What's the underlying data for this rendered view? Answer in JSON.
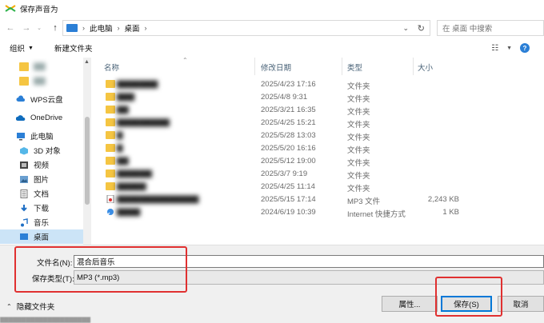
{
  "window": {
    "title": "保存声音为"
  },
  "nav": {
    "breadcrumb": [
      "此电脑",
      "桌面"
    ],
    "search_placeholder": "在 桌面 中搜索"
  },
  "toolbar": {
    "organize": "组织",
    "new_folder": "新建文件夹"
  },
  "sidebar": {
    "items": [
      {
        "label": "",
        "icon": "folder-icon",
        "blurred": true
      },
      {
        "label": "",
        "icon": "folder-icon",
        "blurred": true
      },
      {
        "label": "WPS云盘",
        "icon": "cloud-icon"
      },
      {
        "label": "OneDrive",
        "icon": "onedrive-icon"
      },
      {
        "label": "此电脑",
        "icon": "pc-icon"
      },
      {
        "label": "3D 对象",
        "icon": "3d-objects-icon"
      },
      {
        "label": "视频",
        "icon": "video-icon"
      },
      {
        "label": "图片",
        "icon": "pictures-icon"
      },
      {
        "label": "文档",
        "icon": "documents-icon"
      },
      {
        "label": "下载",
        "icon": "download-icon"
      },
      {
        "label": "音乐",
        "icon": "music-icon"
      },
      {
        "label": "桌面",
        "icon": "desktop-icon",
        "selected": true
      }
    ]
  },
  "columns": {
    "name": "名称",
    "date": "修改日期",
    "type": "类型",
    "size": "大小"
  },
  "files": [
    {
      "name": "",
      "date": "2025/4/23 17:16",
      "type": "文件夹",
      "size": "",
      "icon": "folder-icon",
      "blurred": true
    },
    {
      "name": "",
      "date": "2025/4/8 9:31",
      "type": "文件夹",
      "size": "",
      "icon": "folder-icon",
      "blurred": true
    },
    {
      "name": "",
      "date": "2025/3/21 16:35",
      "type": "文件夹",
      "size": "",
      "icon": "folder-icon",
      "blurred": true
    },
    {
      "name": "",
      "date": "2025/4/25 15:21",
      "type": "文件夹",
      "size": "",
      "icon": "folder-icon",
      "blurred": true
    },
    {
      "name": "",
      "date": "2025/5/28 13:03",
      "type": "文件夹",
      "size": "",
      "icon": "folder-icon",
      "blurred": true
    },
    {
      "name": "",
      "date": "2025/5/20 16:16",
      "type": "文件夹",
      "size": "",
      "icon": "folder-icon",
      "blurred": true
    },
    {
      "name": "",
      "date": "2025/5/12 19:00",
      "type": "文件夹",
      "size": "",
      "icon": "folder-icon",
      "blurred": true
    },
    {
      "name": "",
      "date": "2025/3/7 9:19",
      "type": "文件夹",
      "size": "",
      "icon": "folder-icon",
      "blurred": true
    },
    {
      "name": "",
      "date": "2025/4/25 11:14",
      "type": "文件夹",
      "size": "",
      "icon": "folder-icon",
      "blurred": true
    },
    {
      "name": "",
      "date": "2025/5/15 17:14",
      "type": "MP3 文件",
      "size": "2,243 KB",
      "icon": "mp3-file-icon",
      "blurred": true
    },
    {
      "name": "",
      "date": "2024/6/19 10:39",
      "type": "Internet 快捷方式",
      "size": "1 KB",
      "icon": "shortcut-icon",
      "blurred": true
    }
  ],
  "form": {
    "filename_label": "文件名(N):",
    "filename_value": "混合后音乐",
    "filetype_label": "保存类型(T):",
    "filetype_value": "MP3 (*.mp3)"
  },
  "buttons": {
    "hide_folders": "隐藏文件夹",
    "properties": "属性...",
    "save": "保存(S)",
    "cancel": "取消"
  },
  "colors": {
    "accent": "#0078d7",
    "selection": "#cce4f7",
    "highlight": "#e03030",
    "folder": "#f5c542"
  }
}
